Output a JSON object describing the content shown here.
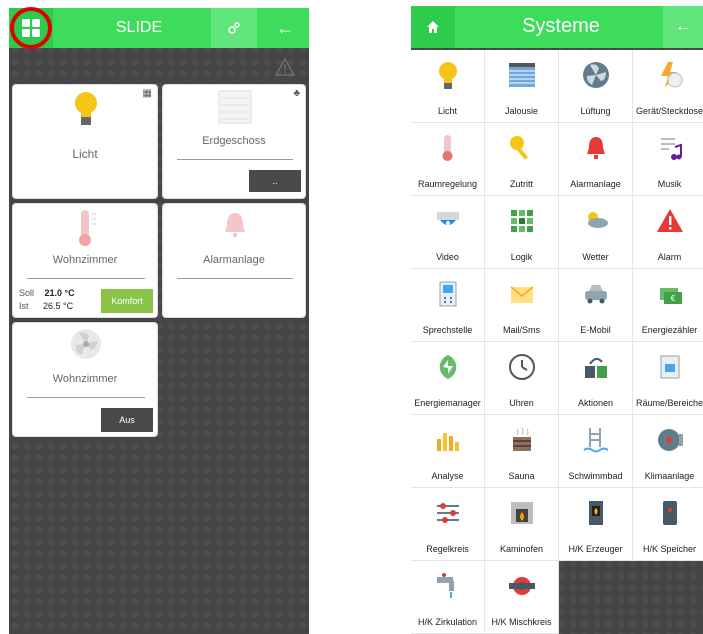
{
  "left": {
    "header": {
      "title": "SLIDE"
    },
    "cards": [
      {
        "label": "Licht",
        "icon": "bulb-icon"
      },
      {
        "label": "Erdgeschoss",
        "button": ".."
      },
      {
        "label": "Wohnzimmer",
        "soll_label": "Soll",
        "soll_value": "21.0 °C",
        "ist_label": "Ist",
        "ist_value": "26.5 °C",
        "button": "Komfort"
      },
      {
        "label": "Alarmanlage"
      },
      {
        "label": "Wohnzimmer",
        "button": "Aus"
      }
    ]
  },
  "right": {
    "header": {
      "title": "Systeme"
    },
    "tiles": [
      {
        "label": "Licht",
        "icon": "bulb-icon"
      },
      {
        "label": "Jalousie",
        "icon": "blinds-icon"
      },
      {
        "label": "Lüftung",
        "icon": "fan-icon"
      },
      {
        "label": "Gerät/Steckdose",
        "icon": "plug-icon"
      },
      {
        "label": "Raumregelung",
        "icon": "thermometer-icon"
      },
      {
        "label": "Zutritt",
        "icon": "key-icon"
      },
      {
        "label": "Alarmanlage",
        "icon": "alarm-icon"
      },
      {
        "label": "Musik",
        "icon": "music-icon"
      },
      {
        "label": "Video",
        "icon": "camera-icon"
      },
      {
        "label": "Logik",
        "icon": "logic-icon"
      },
      {
        "label": "Wetter",
        "icon": "weather-icon"
      },
      {
        "label": "Alarm",
        "icon": "warning-icon"
      },
      {
        "label": "Sprechstelle",
        "icon": "intercom-icon"
      },
      {
        "label": "Mail/Sms",
        "icon": "mail-icon"
      },
      {
        "label": "E-Mobil",
        "icon": "car-icon"
      },
      {
        "label": "Energiezähler",
        "icon": "money-icon"
      },
      {
        "label": "Energiemanager",
        "icon": "leaf-icon"
      },
      {
        "label": "Uhren",
        "icon": "clock-icon"
      },
      {
        "label": "Aktionen",
        "icon": "actions-icon"
      },
      {
        "label": "Räume/Bereiche",
        "icon": "rooms-icon"
      },
      {
        "label": "Analyse",
        "icon": "chart-icon"
      },
      {
        "label": "Sauna",
        "icon": "sauna-icon"
      },
      {
        "label": "Schwimmbad",
        "icon": "pool-icon"
      },
      {
        "label": "Klimaanlage",
        "icon": "aircon-icon"
      },
      {
        "label": "Regelkreis",
        "icon": "sliders-icon"
      },
      {
        "label": "Kaminofen",
        "icon": "fireplace-icon"
      },
      {
        "label": "H/K Erzeuger",
        "icon": "heater-icon"
      },
      {
        "label": "H/K Speicher",
        "icon": "tank-icon"
      },
      {
        "label": "H/K Zirkulation",
        "icon": "tap-icon"
      },
      {
        "label": "H/K Mischkreis",
        "icon": "pump-icon"
      }
    ]
  },
  "colors": {
    "green": "#3ddc5a",
    "dark_green": "#2ecc4c",
    "komfort": "#8bc34a",
    "highlight_circle": "#e00000"
  }
}
